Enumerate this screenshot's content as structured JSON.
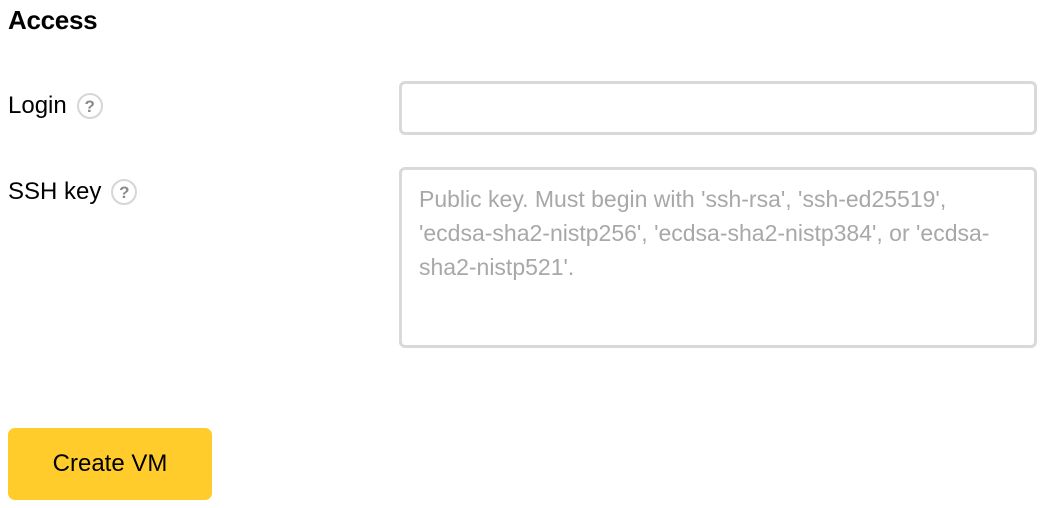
{
  "section": {
    "title": "Access"
  },
  "login": {
    "label": "Login",
    "help_symbol": "?",
    "value": "",
    "placeholder": ""
  },
  "ssh_key": {
    "label": "SSH key",
    "help_symbol": "?",
    "value": "",
    "placeholder": "Public key. Must begin with 'ssh-rsa', 'ssh-ed25519', 'ecdsa-sha2-nistp256', 'ecdsa-sha2-nistp384', or 'ecdsa-sha2-nistp521'."
  },
  "actions": {
    "create_label": "Create VM"
  },
  "colors": {
    "primary_button": "#ffcc2b",
    "input_border": "#d9d9d9",
    "help_icon_border": "#d6d6d6",
    "placeholder": "#a8a8a8"
  },
  "icons": {
    "help": "question-circle-icon"
  }
}
